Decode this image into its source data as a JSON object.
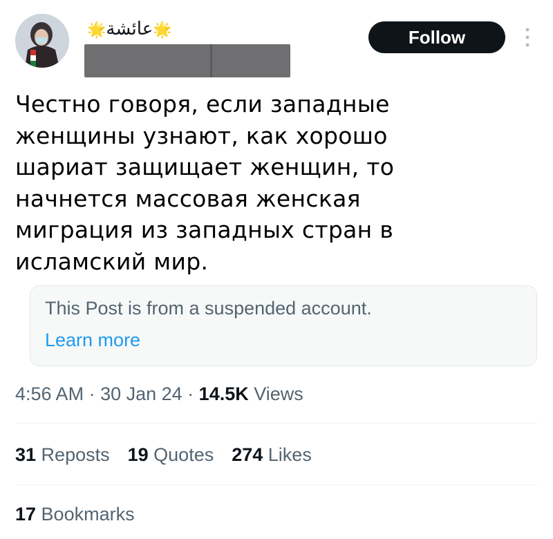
{
  "author": {
    "display_name": "عائشة",
    "name_emoji": "star-emoji",
    "avatar_icon": "avatar-photo",
    "handle_redacted": true
  },
  "actions": {
    "follow_label": "Follow",
    "more_icon": "vertical-ellipsis-icon"
  },
  "post": {
    "lines": [
      "Честно говоря, если западные",
      "женщины узнают, как хорошо",
      "шариат защищает женщин, то",
      "начнется массовая женская",
      "миграция из западных стран в",
      "исламский мир."
    ]
  },
  "notice": {
    "text": "This Post is from a suspended account.",
    "link": "Learn more"
  },
  "meta": {
    "time": "4:56 AM",
    "separator": " · ",
    "date": "30 Jan 24",
    "views_count": "14.5K",
    "views_label": " Views"
  },
  "stats": {
    "reposts_count": "31",
    "reposts_label": " Reposts",
    "quotes_count": "19",
    "quotes_label": " Quotes",
    "likes_count": "274",
    "likes_label": " Likes",
    "bookmarks_count": "17",
    "bookmarks_label": " Bookmarks"
  },
  "colors": {
    "text_primary": "#0f1419",
    "text_secondary": "#536471",
    "link": "#1d9bf0",
    "follow_bg": "#0f1419",
    "star": "#f5c518",
    "redaction": "#6f6f71"
  }
}
